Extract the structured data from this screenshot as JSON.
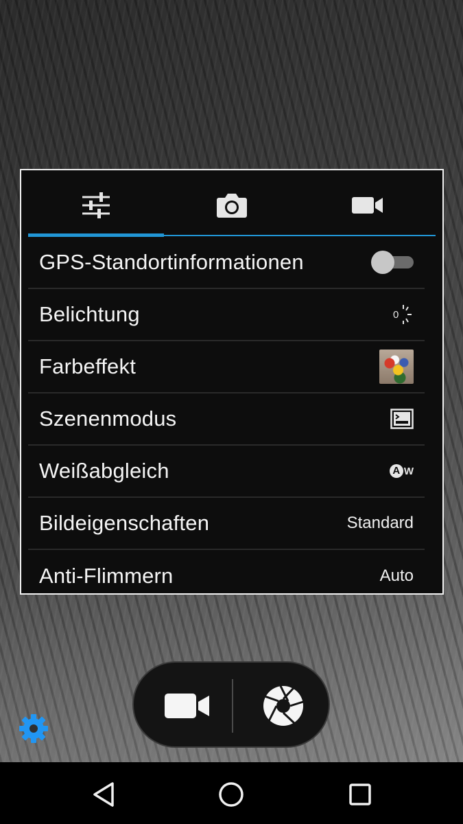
{
  "tabs": [
    {
      "name": "settings-tab",
      "icon": "sliders-icon",
      "active": true
    },
    {
      "name": "photo-tab",
      "icon": "camera-icon",
      "active": false
    },
    {
      "name": "video-tab",
      "icon": "videocam-icon",
      "active": false
    }
  ],
  "settings": {
    "gps": {
      "label": "GPS-Standortinformationen",
      "enabled": false
    },
    "exposure": {
      "label": "Belichtung",
      "value": "0",
      "icon": "exposure-icon"
    },
    "color_effect": {
      "label": "Farbeffekt",
      "icon": "color-effect-thumbnail"
    },
    "scene_mode": {
      "label": "Szenenmodus",
      "icon": "scene-mode-icon"
    },
    "white_balance": {
      "label": "Weißabgleich",
      "value": "A",
      "value_suffix": "W",
      "icon": "auto-white-balance-icon"
    },
    "picture_properties": {
      "label": "Bildeigenschaften",
      "value": "Standard"
    },
    "anti_flicker": {
      "label": "Anti-Flimmern",
      "value": "Auto"
    }
  },
  "colors": {
    "accent": "#2196d6",
    "panel_border": "#f2f2f2",
    "gear": "#2196f3"
  }
}
